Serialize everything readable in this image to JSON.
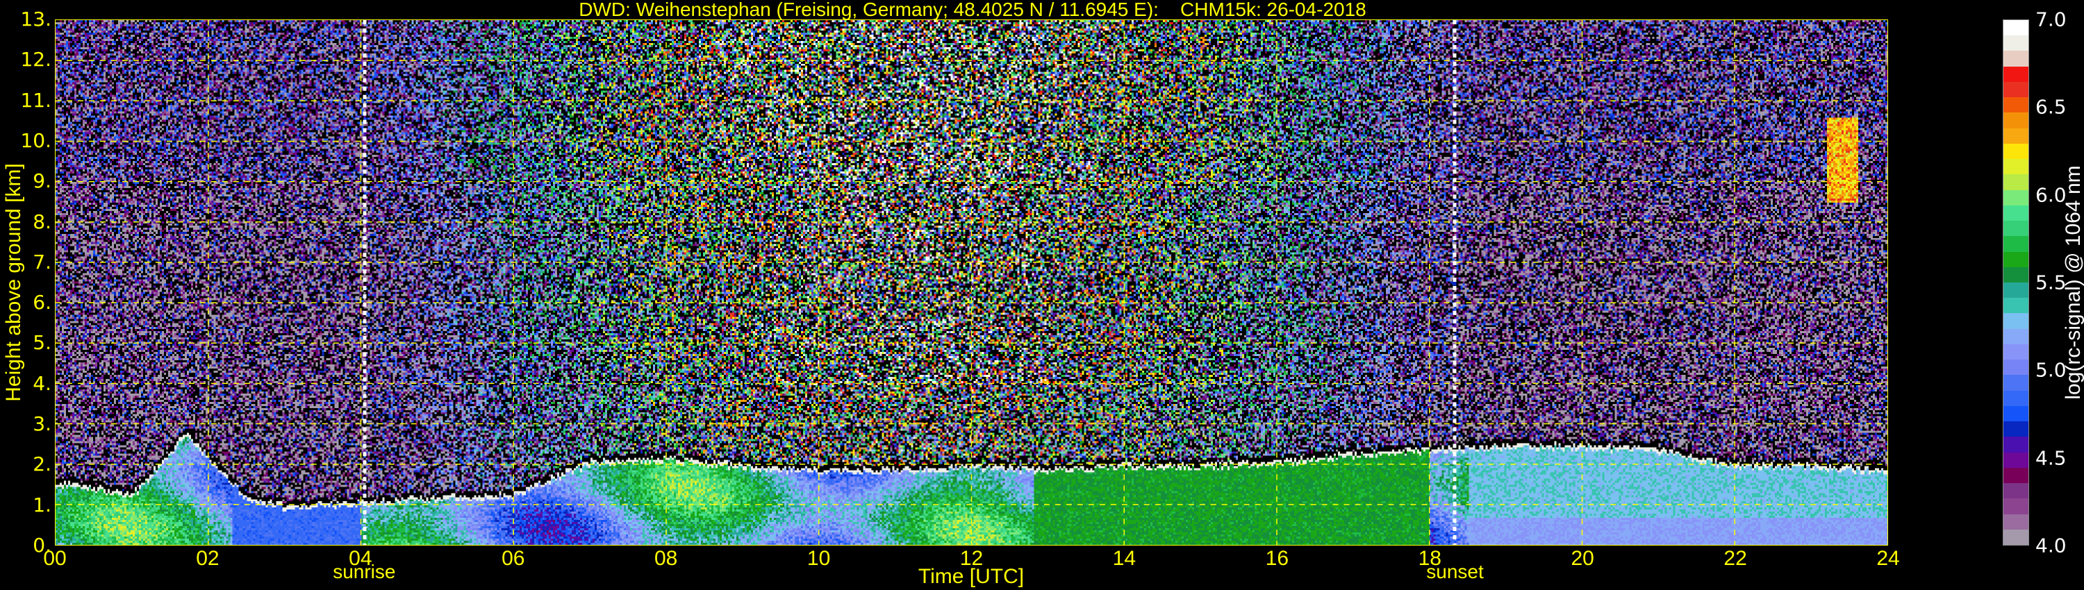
{
  "chart_data": {
    "type": "heatmap",
    "title": "DWD: Weihenstephan (Freising, Germany; 48.4025 N / 11.6945 E):    CHM15k: 26-04-2018",
    "xlabel": "Time [UTC]",
    "ylabel": "Height above ground [km]",
    "xlim": [
      0,
      24
    ],
    "ylim": [
      0,
      13
    ],
    "xticks": [
      "00",
      "02",
      "04",
      "06",
      "08",
      "10",
      "12",
      "14",
      "16",
      "18",
      "20",
      "22",
      "24"
    ],
    "yticks": [
      "0.",
      "1.",
      "2.",
      "3.",
      "4.",
      "5.",
      "6.",
      "7.",
      "8.",
      "9.",
      "10.",
      "11.",
      "12.",
      "13."
    ],
    "grid": true,
    "events": [
      {
        "label": "sunrise",
        "time": 4.05
      },
      {
        "label": "sunset",
        "time": 18.33
      }
    ],
    "boundary_layer_top_km": {
      "time": [
        0,
        1,
        1.7,
        2.5,
        3,
        4,
        5,
        6,
        7,
        8,
        9,
        10,
        11,
        12,
        13,
        14,
        15,
        16,
        17,
        18,
        19,
        20,
        21,
        22,
        23,
        24
      ],
      "height": [
        1.6,
        1.3,
        2.8,
        1.2,
        1.0,
        1.1,
        1.2,
        1.3,
        2.1,
        2.2,
        2.0,
        1.9,
        1.9,
        2.0,
        1.9,
        2.0,
        2.0,
        2.1,
        2.3,
        2.4,
        2.5,
        2.5,
        2.4,
        2.0,
        2.0,
        1.9
      ]
    },
    "cirrus_cloud": {
      "time": [
        23.2,
        23.6
      ],
      "height_km": [
        8.5,
        10.6
      ]
    },
    "colorbar": {
      "label": "log(rc-signal) @ 1064 nm",
      "range": [
        4.0,
        7.0
      ],
      "ticks": [
        "7.0",
        "6.5",
        "6.0",
        "5.5",
        "5.0",
        "4.5",
        "4.0"
      ],
      "colors_top_to_bottom": [
        "#ffffff",
        "#efefe8",
        "#e8cec2",
        "#f21612",
        "#ea3020",
        "#f25a08",
        "#f39208",
        "#f8a810",
        "#fde50a",
        "#e2f02a",
        "#b9ea46",
        "#7aea7a",
        "#46e08e",
        "#36d078",
        "#1ebc46",
        "#1aa818",
        "#14903c",
        "#26a898",
        "#38c4b0",
        "#7ac0f0",
        "#88a8f8",
        "#8894f8",
        "#7684f6",
        "#4c74f4",
        "#3468f6",
        "#1454f8",
        "#0826c0",
        "#4a10b0",
        "#6e0898",
        "#780058",
        "#7c3488",
        "#8c4490",
        "#9a6ca0",
        "#a49aac"
      ]
    }
  }
}
